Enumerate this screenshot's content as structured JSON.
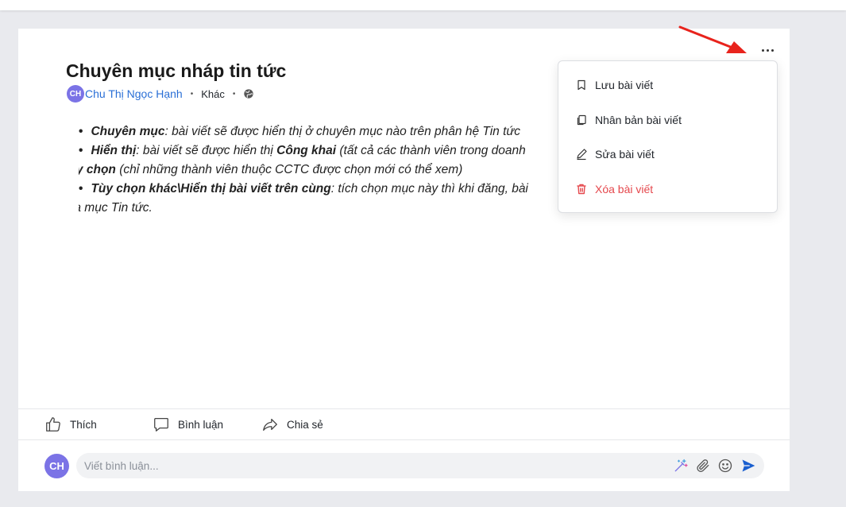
{
  "post": {
    "title": "Chuyên mục nháp tin tức",
    "author_initials": "CH",
    "author_name": "Chu Thị Ngọc Hạnh",
    "category": "Khác",
    "separator": "•",
    "bullet": "•",
    "content": {
      "line1_bold": "Chuyên mục",
      "line1_text": ": bài viết sẽ được hiển thị ở chuyên mục nào trên phân hệ Tin tức",
      "line2_bold": "Hiển thị",
      "line2_text": ": bài viết sẽ được hiển thị ",
      "line2_bold2": "Công khai",
      "line2_text2": " (tất cả các thành viên trong doanh",
      "line3_bold": "Tùy chọn",
      "line3_text": " (chỉ những thành viên thuộc CCTC được chọn mới có thể xem)",
      "line4_bold": "Tùy chọn khác\\Hiển thị bài viết trên cùng",
      "line4_text": ": tích chọn mục này thì khi đăng, bài",
      "line5_text": "của mục Tin tức."
    }
  },
  "actions": {
    "like": "Thích",
    "comment": "Bình luận",
    "share": "Chia sẻ"
  },
  "comment_box": {
    "avatar_initials": "CH",
    "placeholder": "Viết bình luận..."
  },
  "menu": {
    "items": [
      {
        "label": "Lưu bài viết",
        "icon": "bookmark-icon"
      },
      {
        "label": "Nhân bản bài viết",
        "icon": "copy-icon"
      },
      {
        "label": "Sửa bài viết",
        "icon": "pencil-icon"
      },
      {
        "label": "Xóa bài viết",
        "icon": "trash-icon"
      }
    ]
  },
  "colors": {
    "accent": "#2a6fd6",
    "avatar": "#7b73e6",
    "danger": "#e5484d",
    "annotation_arrow": "#e8231c"
  }
}
